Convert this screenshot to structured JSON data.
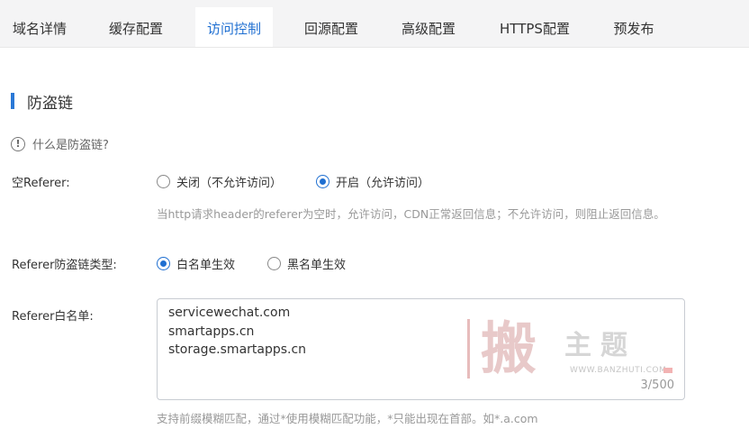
{
  "tabs": [
    {
      "label": "域名详情",
      "active": false
    },
    {
      "label": "缓存配置",
      "active": false
    },
    {
      "label": "访问控制",
      "active": true
    },
    {
      "label": "回源配置",
      "active": false
    },
    {
      "label": "高级配置",
      "active": false
    },
    {
      "label": "HTTPS配置",
      "active": false
    },
    {
      "label": "预发布",
      "active": false
    }
  ],
  "section": {
    "title": "防盗链",
    "help_link": "什么是防盗链?"
  },
  "empty_referer": {
    "label": "空Referer:",
    "option_off": "关闭（不允许访问）",
    "option_on": "开启（允许访问）",
    "selected": "on",
    "hint": "当http请求header的referer为空时，允许访问，CDN正常返回信息；不允许访问，则阻止返回信息。"
  },
  "referer_type": {
    "label": "Referer防盗链类型:",
    "option_white": "白名单生效",
    "option_black": "黑名单生效",
    "selected": "white"
  },
  "whitelist": {
    "label": "Referer白名单:",
    "lines": [
      "servicewechat.com",
      "smartapps.cn",
      "storage.smartapps.cn"
    ],
    "counter": "3/500",
    "hint": "支持前缀模糊匹配，通过*使用模糊匹配功能，*只能出现在首部。如*.a.com"
  },
  "watermark": {
    "big_char": "搬",
    "small_text": "主题",
    "url": "WWW.BANZHUTI.COM"
  },
  "colors": {
    "accent": "#1f6fd1",
    "section_bar": "#2a78d6",
    "hint_text": "#999999",
    "tabbar_bg": "#f4f4f5"
  }
}
